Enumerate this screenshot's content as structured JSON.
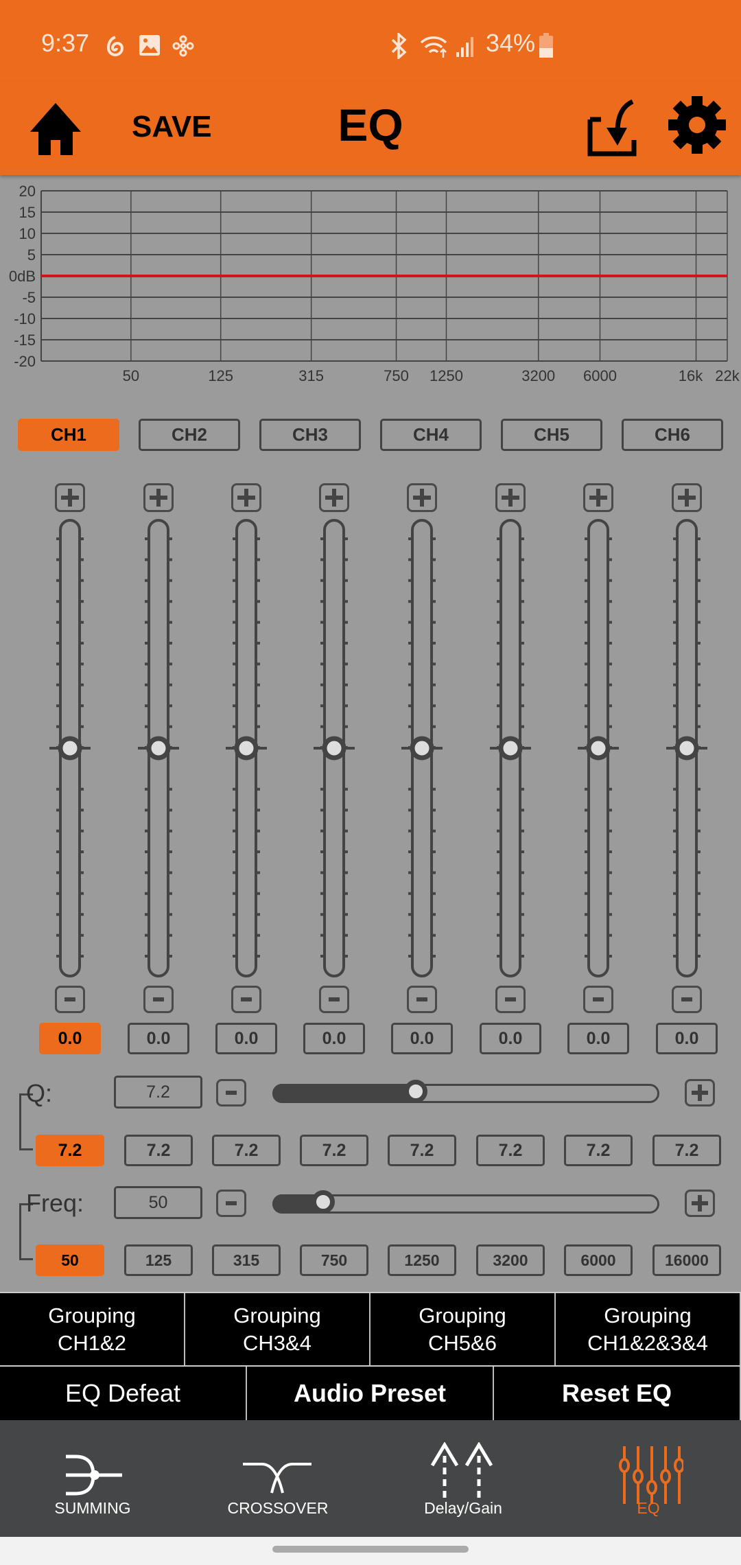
{
  "status_bar": {
    "time": "9:37",
    "battery": "34%",
    "icons": [
      "spiral-icon",
      "gallery-icon",
      "flower-icon",
      "bluetooth-icon",
      "wifi-icon",
      "signal-icon",
      "battery-icon"
    ]
  },
  "header": {
    "title": "EQ",
    "save_label": "SAVE",
    "icons": [
      "home-icon",
      "import-icon",
      "gear-icon"
    ]
  },
  "chart_data": {
    "type": "line",
    "x_scale": "log",
    "xlim": [
      20,
      22000
    ],
    "ylim": [
      -20,
      20
    ],
    "x_ticks": [
      50,
      125,
      315,
      750,
      1250,
      3200,
      6000,
      16000,
      22000
    ],
    "x_tick_labels": [
      "50",
      "125",
      "315",
      "750",
      "1250",
      "3200",
      "6000",
      "16k",
      "22k"
    ],
    "y_ticks": [
      20,
      15,
      10,
      5,
      0,
      -5,
      -10,
      -15,
      -20
    ],
    "y_tick_labels": [
      "20",
      "15",
      "10",
      "5",
      "0dB",
      "-5",
      "-10",
      "-15",
      "-20"
    ],
    "grid": true,
    "series": [
      {
        "color": "#d0161c",
        "x": [
          20,
          22000
        ],
        "y": [
          0,
          0
        ]
      }
    ]
  },
  "channels": [
    "CH1",
    "CH2",
    "CH3",
    "CH4",
    "CH5",
    "CH6"
  ],
  "active_channel": 0,
  "bands": {
    "gains": [
      "0.0",
      "0.0",
      "0.0",
      "0.0",
      "0.0",
      "0.0",
      "0.0",
      "0.0"
    ],
    "gain_db_values": [
      0,
      0,
      0,
      0,
      0,
      0,
      0,
      0
    ],
    "gain_range_db": [
      -20,
      20
    ],
    "active_band": 0
  },
  "q": {
    "label": "Q:",
    "value": "7.2",
    "slider_fraction": 0.365,
    "values": [
      "7.2",
      "7.2",
      "7.2",
      "7.2",
      "7.2",
      "7.2",
      "7.2",
      "7.2"
    ]
  },
  "freq": {
    "label": "Freq:",
    "value": "50",
    "slider_fraction": 0.126,
    "values": [
      "50",
      "125",
      "315",
      "750",
      "1250",
      "3200",
      "6000",
      "16000"
    ]
  },
  "grouping": [
    {
      "line1": "Grouping",
      "line2": "CH1&2"
    },
    {
      "line1": "Grouping",
      "line2": "CH3&4"
    },
    {
      "line1": "Grouping",
      "line2": "CH5&6"
    },
    {
      "line1": "Grouping",
      "line2": "CH1&2&3&4"
    }
  ],
  "actions": [
    "EQ Defeat",
    "Audio Preset",
    "Reset EQ"
  ],
  "nav": [
    {
      "label": "SUMMING",
      "icon": "summing-icon"
    },
    {
      "label": "CROSSOVER",
      "icon": "crossover-icon"
    },
    {
      "label": "Delay/Gain",
      "icon": "delay-gain-icon"
    },
    {
      "label": "EQ",
      "icon": "eq-sliders-icon",
      "active": true
    }
  ],
  "colors": {
    "accent": "#ec6b1c",
    "background": "#9b9b9b",
    "curve": "#d0161c",
    "nav_bg": "#454647"
  }
}
